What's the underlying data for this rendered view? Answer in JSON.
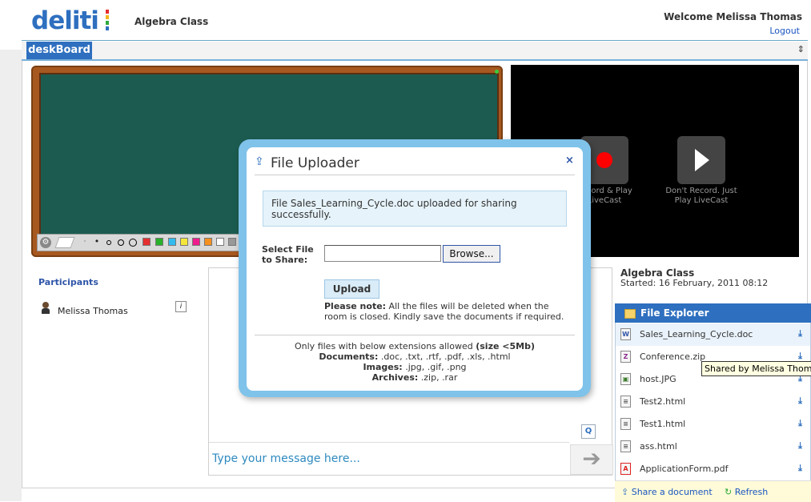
{
  "header": {
    "logo_text": "deliti",
    "logo_bar_colors": [
      "#e52b2b",
      "#f2b81a",
      "#2eaa3a",
      "#2e6fbf"
    ],
    "class_title": "Algebra Class",
    "welcome": "Welcome Melissa Thomas",
    "logout": "Logout"
  },
  "tabs": {
    "active": "deskBoard",
    "scroll_glyph": "⇕"
  },
  "board": {
    "tool_icons": [
      "gear-icon",
      "eraser-icon",
      "dot-tiny",
      "dot-small",
      "circle-small",
      "circle-medium",
      "circle-large"
    ],
    "swatches": [
      "#e53030",
      "#27b02a",
      "#33bbee",
      "#f5e63c",
      "#ee1c8c",
      "#f6901e",
      "#ffffff",
      "#999999"
    ]
  },
  "video": {
    "record_label": "Record & Play LiveCast",
    "play_label": "Don't Record. Just Play LiveCast"
  },
  "participants": {
    "title": "Participants",
    "items": [
      {
        "name": "Melissa Thomas",
        "info": "i"
      }
    ]
  },
  "chat": {
    "search_label": "Q",
    "input_placeholder": "Type your message here...",
    "send_glyph": "➔"
  },
  "class_info": {
    "name": "Algebra Class",
    "started": "Started: 16 February, 2011 08:12"
  },
  "file_explorer": {
    "title": "File Explorer",
    "files": [
      {
        "name": "Sales_Learning_Cycle.doc",
        "icon": "word-doc-icon",
        "badge": "W"
      },
      {
        "name": "Conference.zip",
        "icon": "zip-archive-icon",
        "badge": "Z"
      },
      {
        "name": "host.JPG",
        "icon": "image-file-icon",
        "badge": "▣"
      },
      {
        "name": "Test2.html",
        "icon": "html-file-icon",
        "badge": "≡"
      },
      {
        "name": "Test1.html",
        "icon": "html-file-icon",
        "badge": "≡"
      },
      {
        "name": "ass.html",
        "icon": "html-file-icon",
        "badge": "≡"
      },
      {
        "name": "ApplicationForm.pdf",
        "icon": "pdf-file-icon",
        "badge": "A"
      }
    ],
    "download_glyph": "⤓",
    "share_label": "Share a document",
    "refresh_label": "Refresh",
    "tooltip": "Shared by Melissa Thomas"
  },
  "modal": {
    "title": "File Uploader",
    "close_glyph": "×",
    "message": "File Sales_Learning_Cycle.doc uploaded for sharing successfully.",
    "select_label": "Select File to Share:",
    "file_value": "",
    "browse_label": "Browse...",
    "upload_label": "Upload",
    "note_bold": "Please note:",
    "note_text": " All the files will be deleted when the room is closed. Kindly save the documents if required.",
    "allowed_intro": "Only files with below extensions allowed ",
    "allowed_size": "(size <5Mb)",
    "documents_label": "Documents:",
    "documents_value": " .doc, .txt, .rtf, .pdf, .xls, .html",
    "images_label": "Images:",
    "images_value": " .jpg, .gif, .png",
    "archives_label": "Archives:",
    "archives_value": " .zip, .rar"
  }
}
